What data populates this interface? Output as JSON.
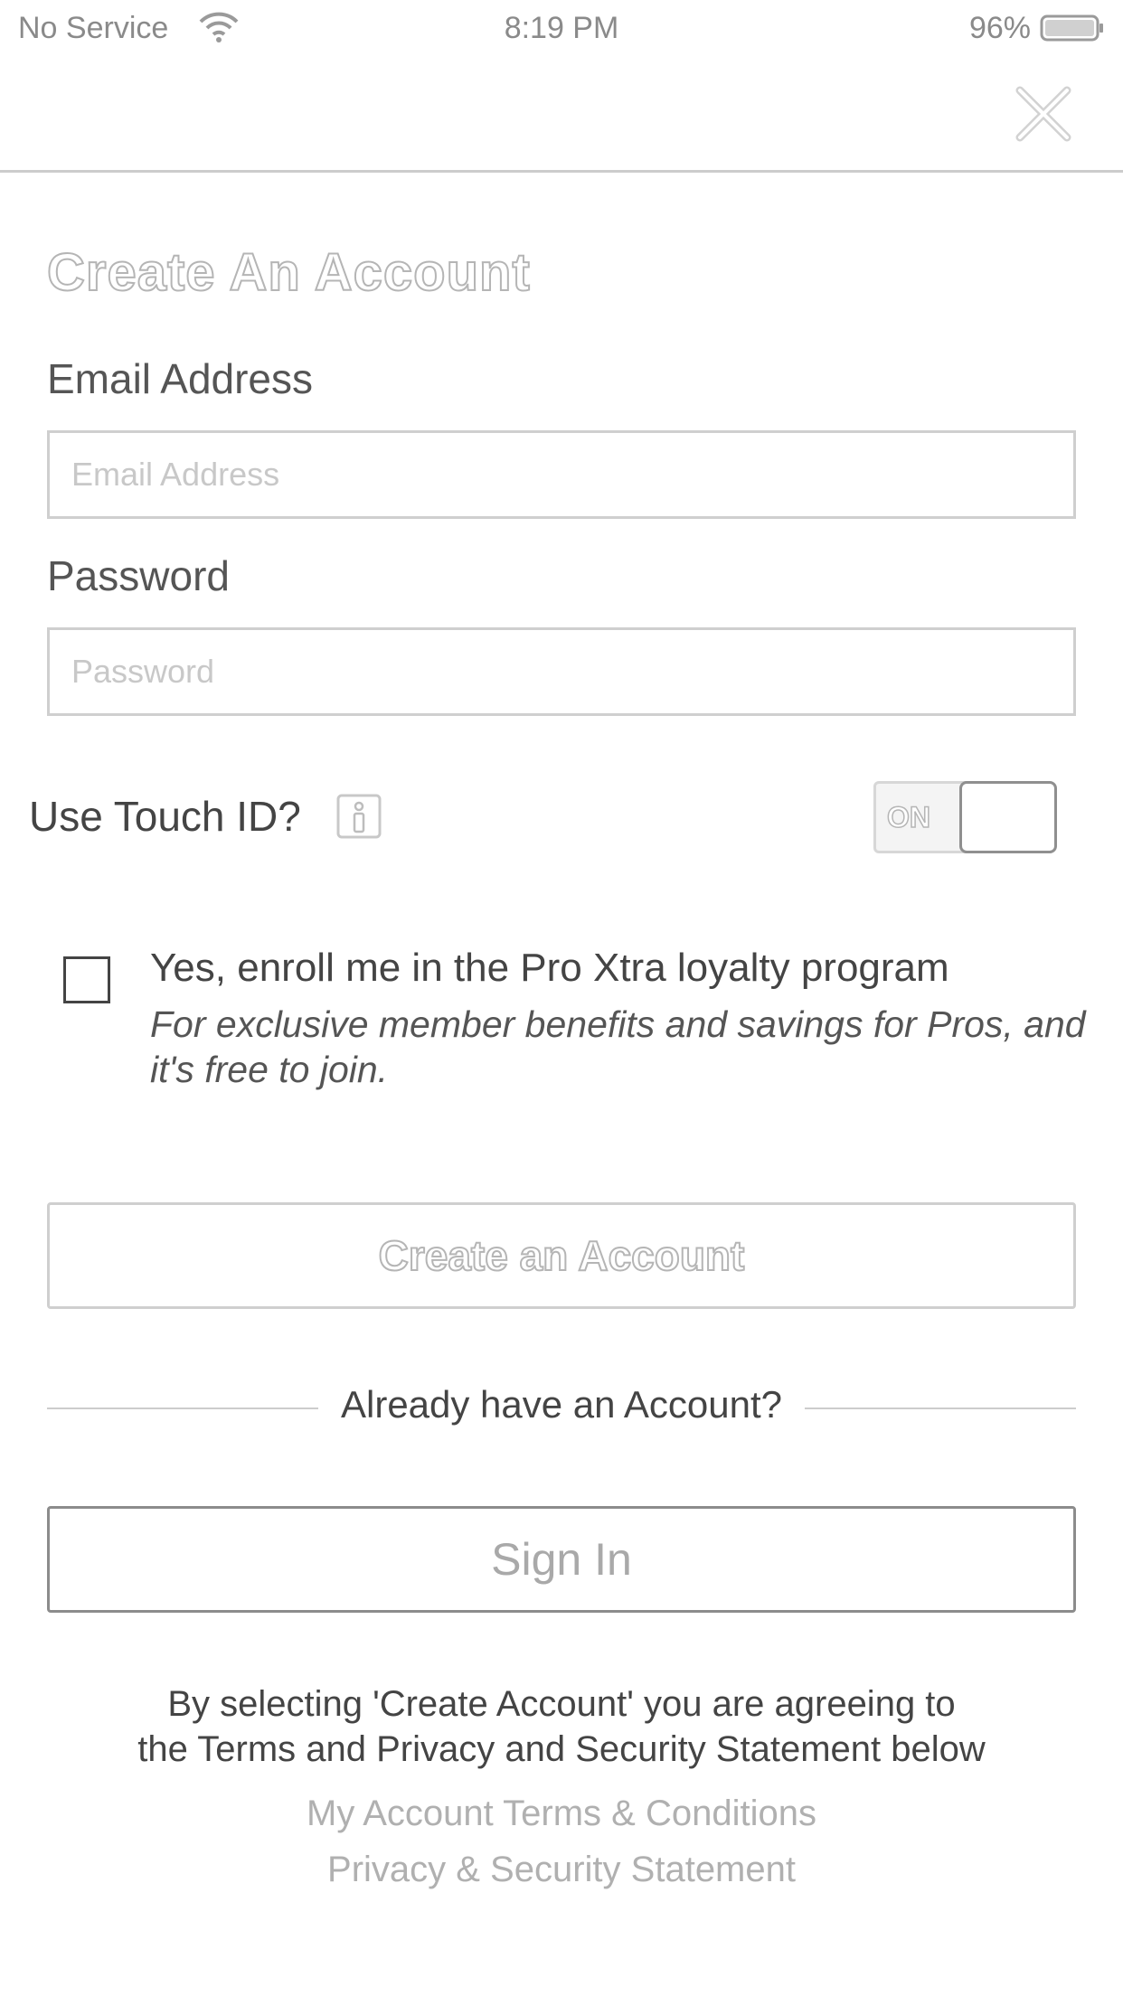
{
  "status_bar": {
    "carrier": "No Service",
    "time": "8:19 PM",
    "battery_percent": "96%",
    "battery_level": 0.96
  },
  "header": {
    "close_icon": "close-icon"
  },
  "page": {
    "title": "Create An Account"
  },
  "form": {
    "email_label": "Email Address",
    "email_placeholder": "Email Address",
    "email_value": "",
    "password_label": "Password",
    "password_placeholder": "Password",
    "password_value": ""
  },
  "touch_id": {
    "label": "Use Touch ID?",
    "info_icon": "info-icon",
    "toggle_label": "ON",
    "enabled": false
  },
  "loyalty": {
    "checked": false,
    "main_text": "Yes, enroll me in the Pro Xtra loyalty program",
    "sub_text": "For exclusive member benefits and savings for Pros, and it's free to join."
  },
  "buttons": {
    "create_account": "Create an Account",
    "sign_in": "Sign In"
  },
  "divider": {
    "text": "Already have an Account?"
  },
  "legal": {
    "line1": "By selecting 'Create Account' you are agreeing to",
    "line2": "the Terms and Privacy and Security Statement below",
    "terms_link": "My Account Terms & Conditions",
    "privacy_link": "Privacy & Security Statement"
  }
}
